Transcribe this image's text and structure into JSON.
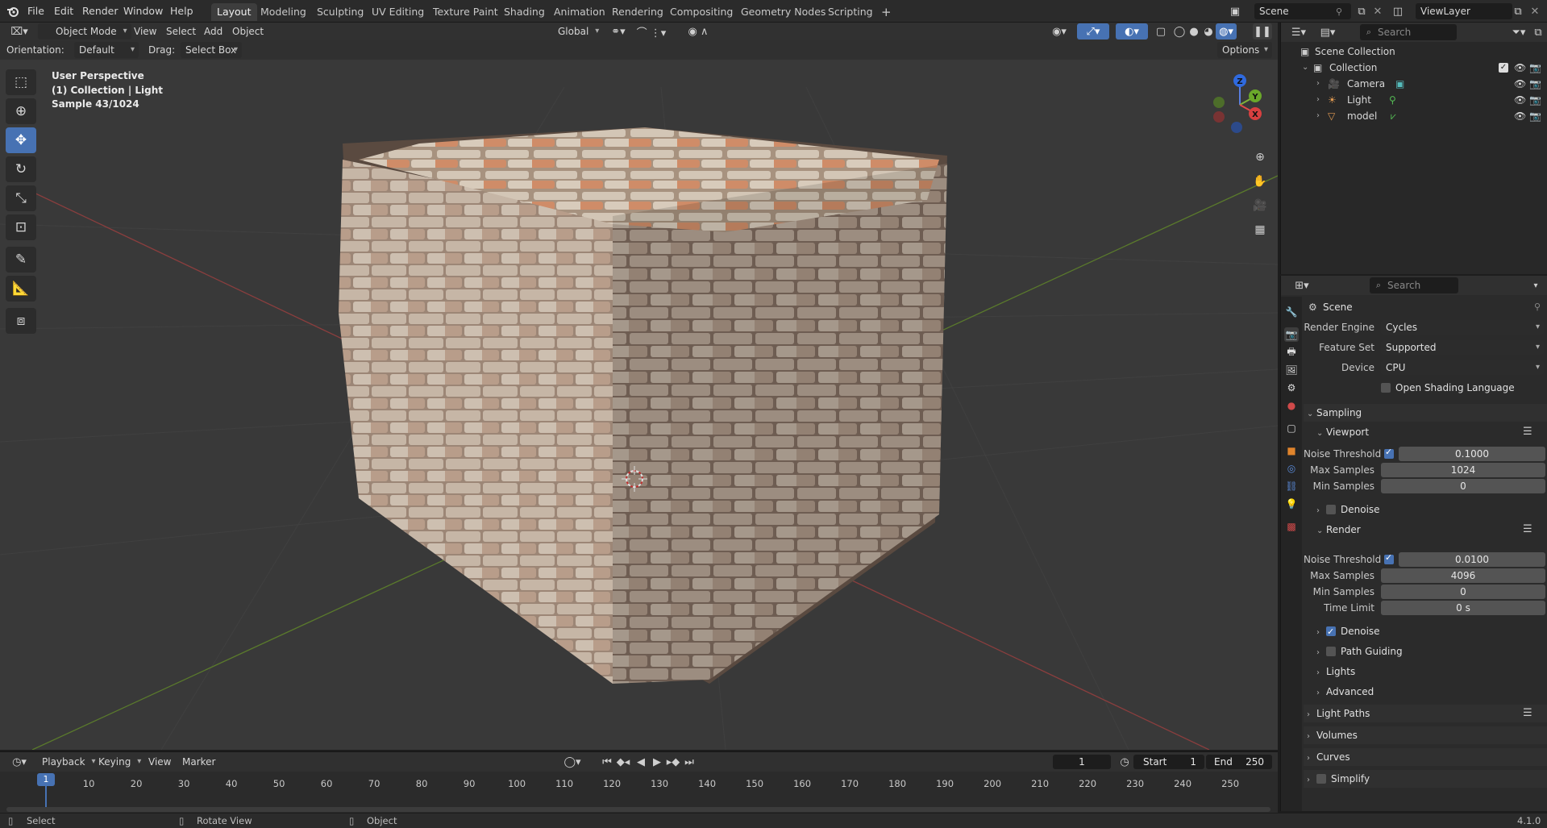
{
  "topbar": {
    "menus": [
      "File",
      "Edit",
      "Render",
      "Window",
      "Help"
    ],
    "workspaces": [
      "Layout",
      "Modeling",
      "Sculpting",
      "UV Editing",
      "Texture Paint",
      "Shading",
      "Animation",
      "Rendering",
      "Compositing",
      "Geometry Nodes",
      "Scripting"
    ],
    "active_workspace": "Layout",
    "add_workspace": "+",
    "scene_name": "Scene",
    "view_layer": "ViewLayer"
  },
  "viewport_header": {
    "mode": "Object Mode",
    "menus": [
      "View",
      "Select",
      "Add",
      "Object"
    ],
    "transform_orientation": "Global",
    "orientation_label": "Orientation:",
    "orientation_value": "Default",
    "drag_label": "Drag:",
    "drag_value": "Select Box",
    "options": "Options"
  },
  "viewport_overlay": {
    "line1": "User Perspective",
    "line2": "(1) Collection | Light",
    "line3": "Sample 43/1024"
  },
  "gizmo": {
    "z": "Z",
    "y": "Y",
    "x": "X"
  },
  "outliner": {
    "search_placeholder": "Search",
    "scene_collection": "Scene Collection",
    "collection": "Collection",
    "items": [
      "Camera",
      "Light",
      "model"
    ]
  },
  "properties": {
    "search_placeholder": "Search",
    "context": "Scene",
    "render_engine_label": "Render Engine",
    "render_engine": "Cycles",
    "feature_set_label": "Feature Set",
    "feature_set": "Supported",
    "device_label": "Device",
    "device": "CPU",
    "osl": "Open Shading Language",
    "sampling": "Sampling",
    "viewport": {
      "title": "Viewport",
      "noise_threshold_label": "Noise Threshold",
      "noise_threshold": "0.1000",
      "max_samples_label": "Max Samples",
      "max_samples": "1024",
      "min_samples_label": "Min Samples",
      "min_samples": "0",
      "denoise": "Denoise"
    },
    "render": {
      "title": "Render",
      "noise_threshold_label": "Noise Threshold",
      "noise_threshold": "0.0100",
      "max_samples_label": "Max Samples",
      "max_samples": "4096",
      "min_samples_label": "Min Samples",
      "min_samples": "0",
      "time_limit_label": "Time Limit",
      "time_limit": "0 s",
      "denoise": "Denoise",
      "path_guiding": "Path Guiding",
      "lights": "Lights",
      "advanced": "Advanced"
    },
    "panels": [
      "Light Paths",
      "Volumes",
      "Curves",
      "Simplify"
    ]
  },
  "timeline": {
    "menus": [
      "Playback",
      "Keying",
      "View",
      "Marker"
    ],
    "current_frame": "1",
    "start_label": "Start",
    "start": "1",
    "end_label": "End",
    "end": "250",
    "playhead": "1",
    "ticks": [
      "10",
      "20",
      "30",
      "40",
      "50",
      "60",
      "70",
      "80",
      "90",
      "100",
      "110",
      "120",
      "130",
      "140",
      "150",
      "160",
      "170",
      "180",
      "190",
      "200",
      "210",
      "220",
      "230",
      "240",
      "250"
    ]
  },
  "statusbar": {
    "select": "Select",
    "rotate": "Rotate View",
    "object": "Object",
    "version": "4.1.0"
  }
}
